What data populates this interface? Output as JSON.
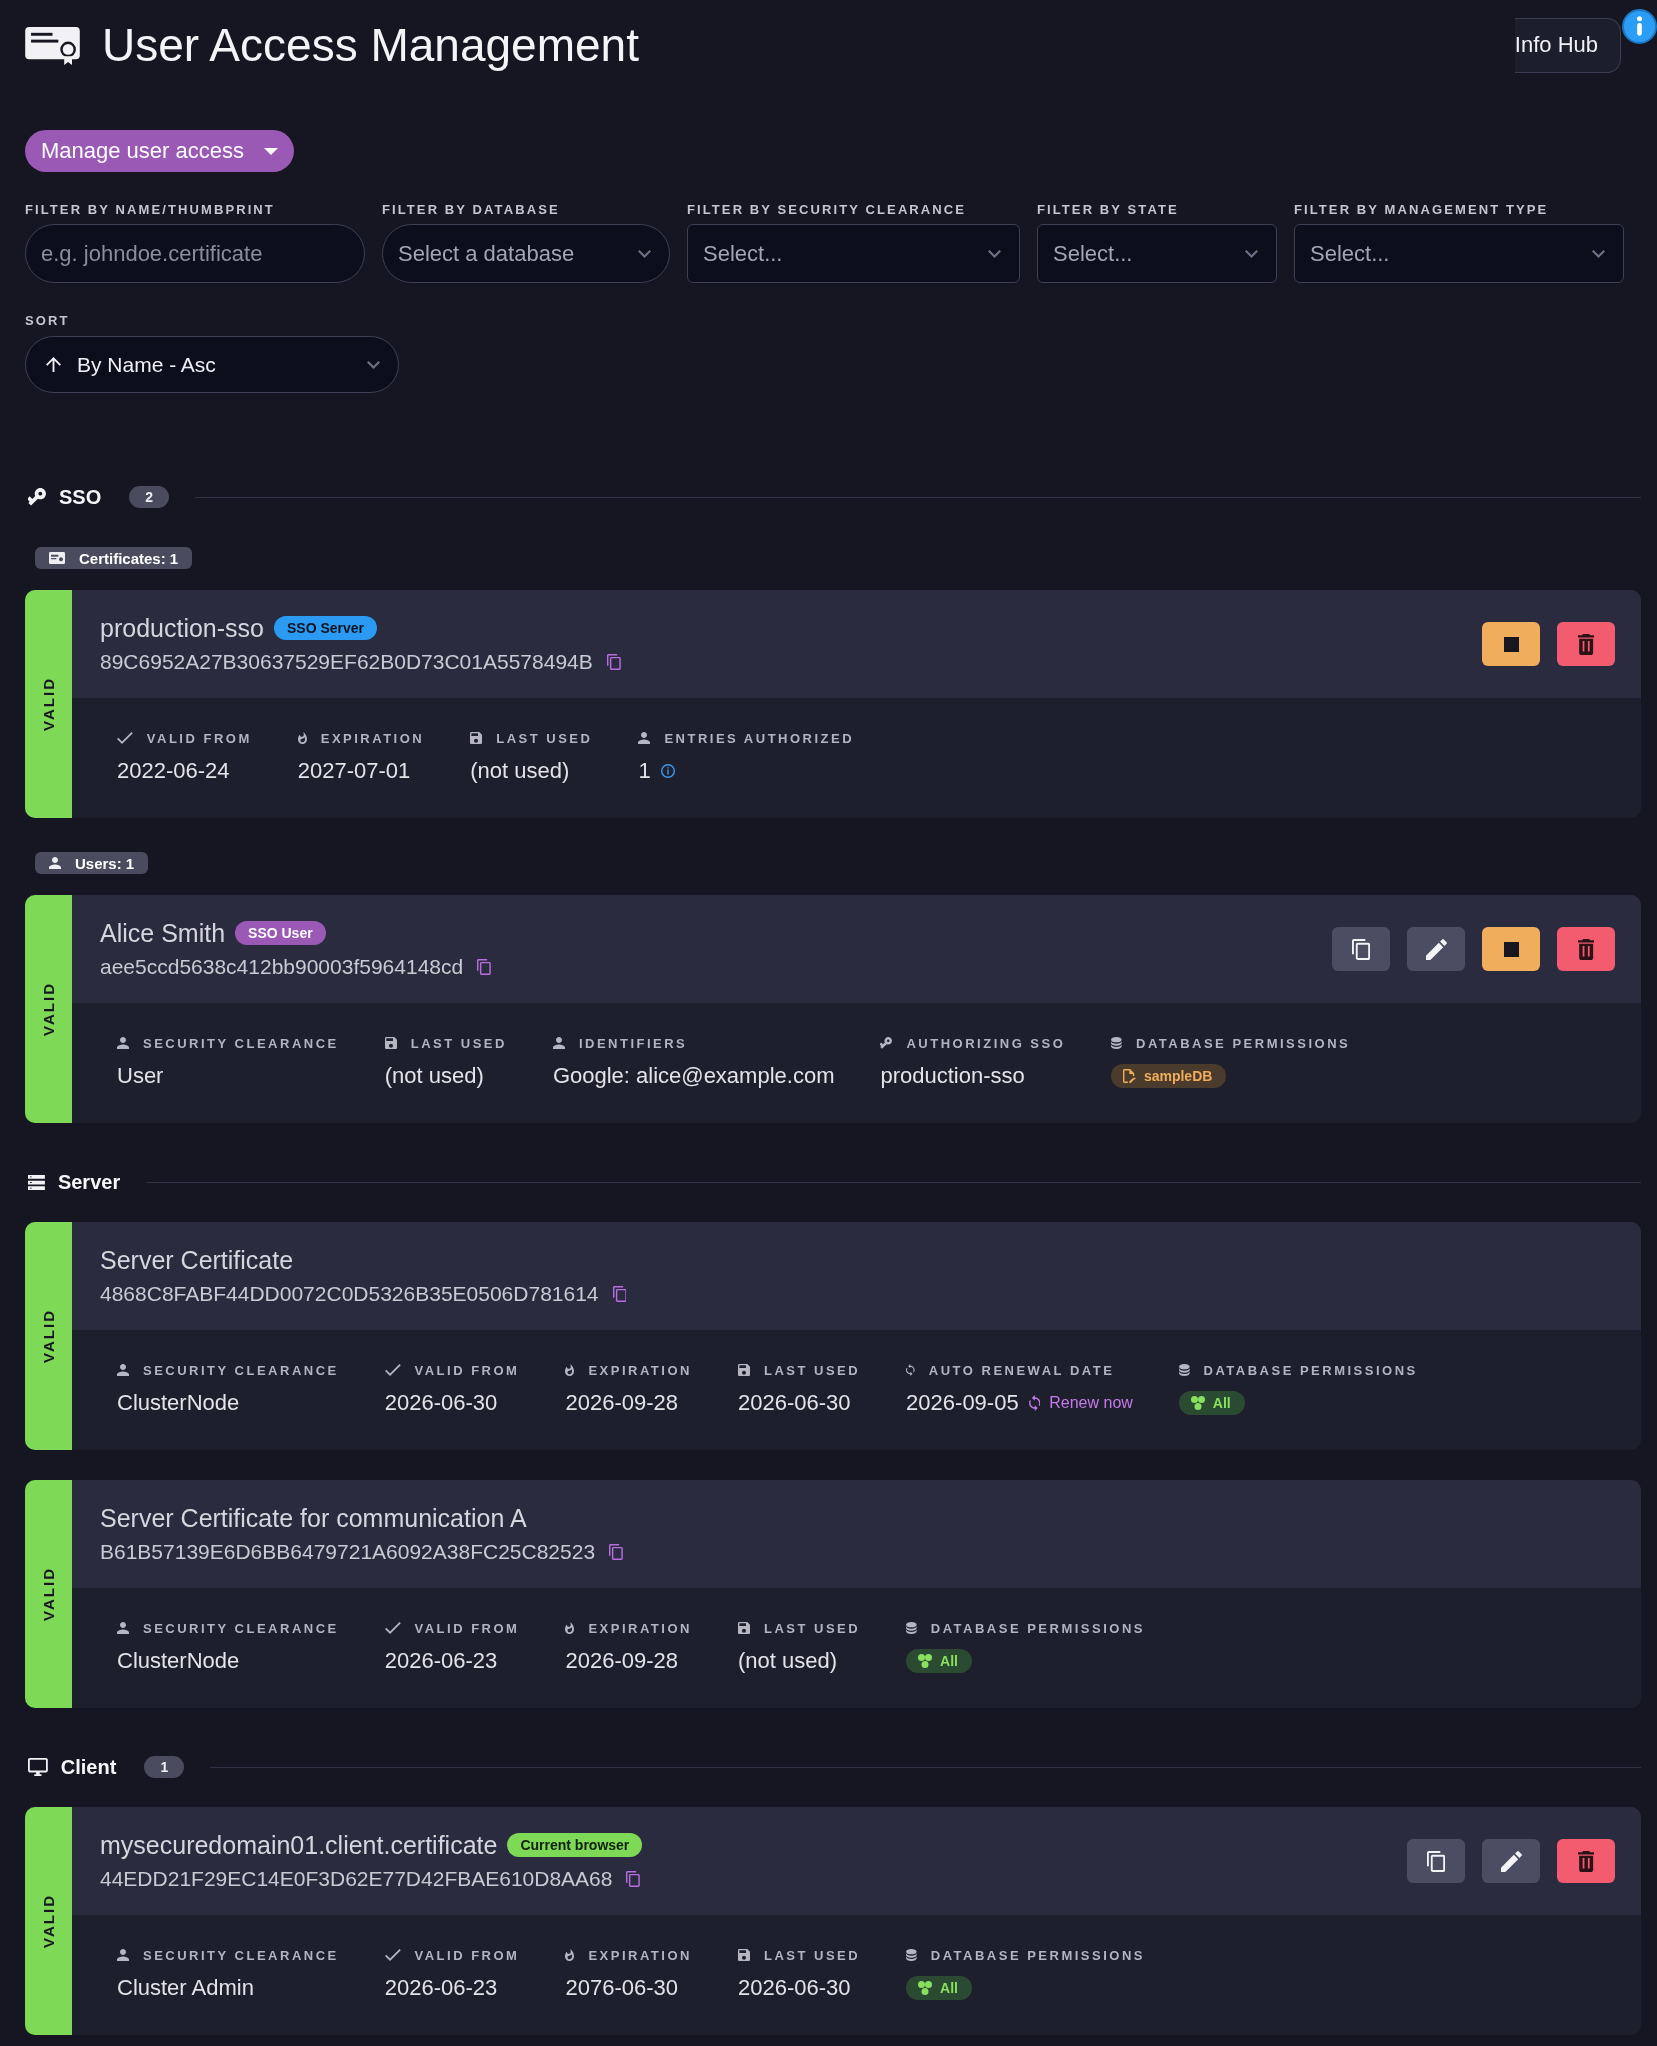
{
  "header": {
    "title": "User Access Management",
    "info_button": "Info Hub"
  },
  "manage_button": "Manage user access",
  "filters": [
    {
      "label": "FILTER BY NAME/THUMBPRINT",
      "kind": "text",
      "placeholder": "e.g. johndoe.certificate"
    },
    {
      "label": "FILTER BY DATABASE",
      "kind": "select",
      "placeholder": "Select a database"
    },
    {
      "label": "FILTER BY SECURITY CLEARANCE",
      "kind": "multiselect",
      "placeholder": "Select..."
    },
    {
      "label": "FILTER BY STATE",
      "kind": "multiselect",
      "placeholder": "Select..."
    },
    {
      "label": "FILTER BY MANAGEMENT TYPE",
      "kind": "multiselect",
      "placeholder": "Select..."
    }
  ],
  "sort": {
    "label": "SORT",
    "value": "By Name - Asc"
  },
  "sections": [
    {
      "title": "SSO",
      "kind": "sso",
      "count": "2",
      "groups": [
        {
          "tag": {
            "label": "Certificates: 1",
            "kind": "certificates"
          },
          "cards": [
            {
              "status": {
                "label": "VALID",
                "kind": "valid"
              },
              "name": "production-sso",
              "badge": {
                "label": "SSO Server",
                "kind": "sso-server"
              },
              "thumbprint": "89C6952A27B30637529EF62B0D73C01A5578494B",
              "actions": [
                {
                  "kind": "stop"
                },
                {
                  "kind": "delete"
                }
              ],
              "details": [
                {
                  "kind": "valid-from",
                  "label": "VALID FROM",
                  "value": "2022-06-24"
                },
                {
                  "kind": "expiration",
                  "label": "EXPIRATION",
                  "value": "2027-07-01"
                },
                {
                  "kind": "last-used",
                  "label": "LAST USED",
                  "value": "(not used)"
                },
                {
                  "kind": "entries",
                  "label": "ENTRIES AUTHORIZED",
                  "value": "1"
                }
              ]
            }
          ]
        },
        {
          "tag": {
            "label": "Users: 1",
            "kind": "users"
          },
          "cards": [
            {
              "status": {
                "label": "VALID",
                "kind": "valid"
              },
              "name": "Alice Smith",
              "badge": {
                "label": "SSO User",
                "kind": "sso-user"
              },
              "thumbprint": "aee5ccd5638c412bb90003f5964148cd",
              "actions": [
                {
                  "kind": "copy"
                },
                {
                  "kind": "edit"
                },
                {
                  "kind": "stop"
                },
                {
                  "kind": "delete"
                }
              ],
              "details": [
                {
                  "kind": "clearance",
                  "label": "SECURITY CLEARANCE",
                  "value": "User"
                },
                {
                  "kind": "last-used",
                  "label": "LAST USED",
                  "value": "(not used)"
                },
                {
                  "kind": "identifiers",
                  "label": "IDENTIFIERS",
                  "value": "Google: alice@example.com"
                },
                {
                  "kind": "authorizing-sso",
                  "label": "AUTHORIZING SSO",
                  "value": "production-sso"
                },
                {
                  "kind": "permissions",
                  "label": "DATABASE PERMISSIONS",
                  "tags": [
                    {
                      "label": "sampleDB",
                      "kind": "database"
                    }
                  ]
                }
              ]
            }
          ]
        }
      ]
    },
    {
      "title": "Server",
      "kind": "server",
      "groups": [
        {
          "cards": [
            {
              "status": {
                "label": "VALID",
                "kind": "valid"
              },
              "name": "Server Certificate",
              "thumbprint": "4868C8FABF44DD0072C0D5326B35E0506D781614",
              "details": [
                {
                  "kind": "clearance",
                  "label": "SECURITY CLEARANCE",
                  "value": "ClusterNode"
                },
                {
                  "kind": "valid-from",
                  "label": "VALID FROM",
                  "value": "2026-06-30"
                },
                {
                  "kind": "expiration",
                  "label": "EXPIRATION",
                  "value": "2026-09-28"
                },
                {
                  "kind": "last-used",
                  "label": "LAST USED",
                  "value": "2026-06-30"
                },
                {
                  "kind": "renewal",
                  "label": "AUTO RENEWAL DATE",
                  "value": "2026-09-05",
                  "link": "Renew now"
                },
                {
                  "kind": "permissions",
                  "label": "DATABASE PERMISSIONS",
                  "tags": [
                    {
                      "label": "All",
                      "kind": "all"
                    }
                  ]
                }
              ]
            },
            {
              "status": {
                "label": "VALID",
                "kind": "valid"
              },
              "name": "Server Certificate for communication A",
              "thumbprint": "B61B57139E6D6BB6479721A6092A38FC25C82523",
              "details": [
                {
                  "kind": "clearance",
                  "label": "SECURITY CLEARANCE",
                  "value": "ClusterNode"
                },
                {
                  "kind": "valid-from",
                  "label": "VALID FROM",
                  "value": "2026-06-23"
                },
                {
                  "kind": "expiration",
                  "label": "EXPIRATION",
                  "value": "2026-09-28"
                },
                {
                  "kind": "last-used",
                  "label": "LAST USED",
                  "value": "(not used)"
                },
                {
                  "kind": "permissions",
                  "label": "DATABASE PERMISSIONS",
                  "tags": [
                    {
                      "label": "All",
                      "kind": "all"
                    }
                  ]
                }
              ]
            }
          ]
        }
      ]
    },
    {
      "title": "Client",
      "kind": "client",
      "count": "1",
      "groups": [
        {
          "cards": [
            {
              "status": {
                "label": "VALID",
                "kind": "valid"
              },
              "name": "mysecuredomain01.client.certificate",
              "badge": {
                "label": "Current browser",
                "kind": "current-browser"
              },
              "thumbprint": "44EDD21F29EC14E0F3D62E77D42FBAE610D8AA68",
              "actions": [
                {
                  "kind": "copy"
                },
                {
                  "kind": "edit"
                },
                {
                  "kind": "delete"
                }
              ],
              "details": [
                {
                  "kind": "clearance",
                  "label": "SECURITY CLEARANCE",
                  "value": "Cluster Admin"
                },
                {
                  "kind": "valid-from",
                  "label": "VALID FROM",
                  "value": "2026-06-23"
                },
                {
                  "kind": "expiration",
                  "label": "EXPIRATION",
                  "value": "2076-06-30"
                },
                {
                  "kind": "last-used",
                  "label": "LAST USED",
                  "value": "2026-06-30"
                },
                {
                  "kind": "permissions",
                  "label": "DATABASE PERMISSIONS",
                  "tags": [
                    {
                      "label": "All",
                      "kind": "all"
                    }
                  ]
                }
              ]
            }
          ]
        }
      ]
    }
  ]
}
